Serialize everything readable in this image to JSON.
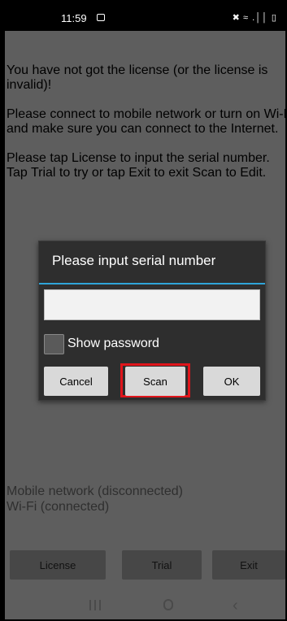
{
  "status": {
    "time": "11:59",
    "right_icons": "✖ ≈ .││ ▯"
  },
  "message": {
    "lines": [
      "You have not got the license (or the license is invalid)!",
      "Please connect to mobile network or turn on Wi-Fi,\nand make sure you can connect to the Internet.",
      "Please tap License to input the serial number.\nTap Trial to try or tap Exit to exit Scan to Edit."
    ]
  },
  "network": {
    "mobile": "Mobile network (disconnected)",
    "wifi": "Wi-Fi (connected)"
  },
  "bottom": {
    "license": "License",
    "trial": "Trial",
    "exit": "Exit"
  },
  "dialog": {
    "title": "Please input serial number",
    "input_value": "",
    "show_password": "Show password",
    "cancel": "Cancel",
    "scan": "Scan",
    "ok": "OK"
  },
  "colors": {
    "highlight": "#e0151b",
    "accent": "#2fa4d9"
  }
}
